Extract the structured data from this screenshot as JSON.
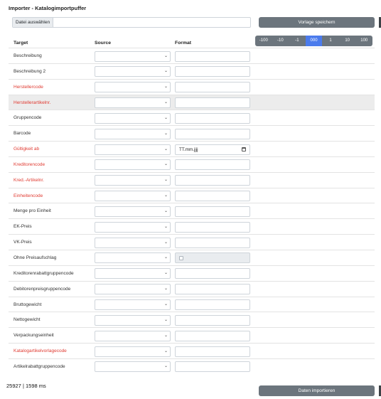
{
  "page": {
    "title": "Importer - Katalogimportpuffer"
  },
  "file_input": {
    "button_label": "Datei auswählen"
  },
  "save_button": {
    "label": "Vorlage speichern"
  },
  "import_button": {
    "label": "Daten importieren"
  },
  "offsets": {
    "selected": "000",
    "options": [
      "-100",
      "-10",
      "-1",
      "000",
      "1",
      "10",
      "100"
    ]
  },
  "columns": {
    "target": "Target",
    "source": "Source",
    "format": "Format"
  },
  "rows": [
    {
      "target": "Beschreibung",
      "required": false,
      "format_kind": "text",
      "format_value": ""
    },
    {
      "target": "Beschreibung 2",
      "required": false,
      "format_kind": "text",
      "format_value": ""
    },
    {
      "target": "Herstellercode",
      "required": true,
      "format_kind": "text",
      "format_value": ""
    },
    {
      "target": "Herstellerartikelnr.",
      "required": true,
      "format_kind": "text",
      "format_value": "",
      "highlighted": true
    },
    {
      "target": "Gruppencode",
      "required": false,
      "format_kind": "text",
      "format_value": ""
    },
    {
      "target": "Barcode",
      "required": false,
      "format_kind": "text",
      "format_value": ""
    },
    {
      "target": "Gültigkeit ab",
      "required": true,
      "format_kind": "date",
      "format_value": "TT.mm.jjjj"
    },
    {
      "target": "Kreditorencode",
      "required": true,
      "format_kind": "text",
      "format_value": ""
    },
    {
      "target": "Kred.-Artikelnr.",
      "required": true,
      "format_kind": "text",
      "format_value": ""
    },
    {
      "target": "Einheitencode",
      "required": true,
      "format_kind": "text",
      "format_value": ""
    },
    {
      "target": "Menge pro Einheit",
      "required": false,
      "format_kind": "text",
      "format_value": ""
    },
    {
      "target": "EK-Preis",
      "required": false,
      "format_kind": "text",
      "format_value": ""
    },
    {
      "target": "VK-Preis",
      "required": false,
      "format_kind": "text",
      "format_value": ""
    },
    {
      "target": "Ohne Preisaufschlag",
      "required": false,
      "format_kind": "checkbox",
      "format_value": ""
    },
    {
      "target": "Kreditorenrabattgruppencode",
      "required": false,
      "format_kind": "text",
      "format_value": ""
    },
    {
      "target": "Debitorenpreisgruppencode",
      "required": false,
      "format_kind": "text",
      "format_value": ""
    },
    {
      "target": "Bruttogewicht",
      "required": false,
      "format_kind": "text",
      "format_value": ""
    },
    {
      "target": "Nettogewicht",
      "required": false,
      "format_kind": "text",
      "format_value": ""
    },
    {
      "target": "Verpackungseinheit",
      "required": false,
      "format_kind": "text",
      "format_value": ""
    },
    {
      "target": "Katalogartikelvorlagecode",
      "required": true,
      "format_kind": "text",
      "format_value": ""
    },
    {
      "target": "Artikelrabattgruppencode",
      "required": false,
      "format_kind": "text",
      "format_value": ""
    }
  ],
  "status": {
    "timing": "25927 | 1598 ms"
  },
  "colors": {
    "required_label": "#e03b32",
    "button_bg": "#6c757d",
    "active_offset": "#4b7bec",
    "highlight_row": "#ececec"
  }
}
